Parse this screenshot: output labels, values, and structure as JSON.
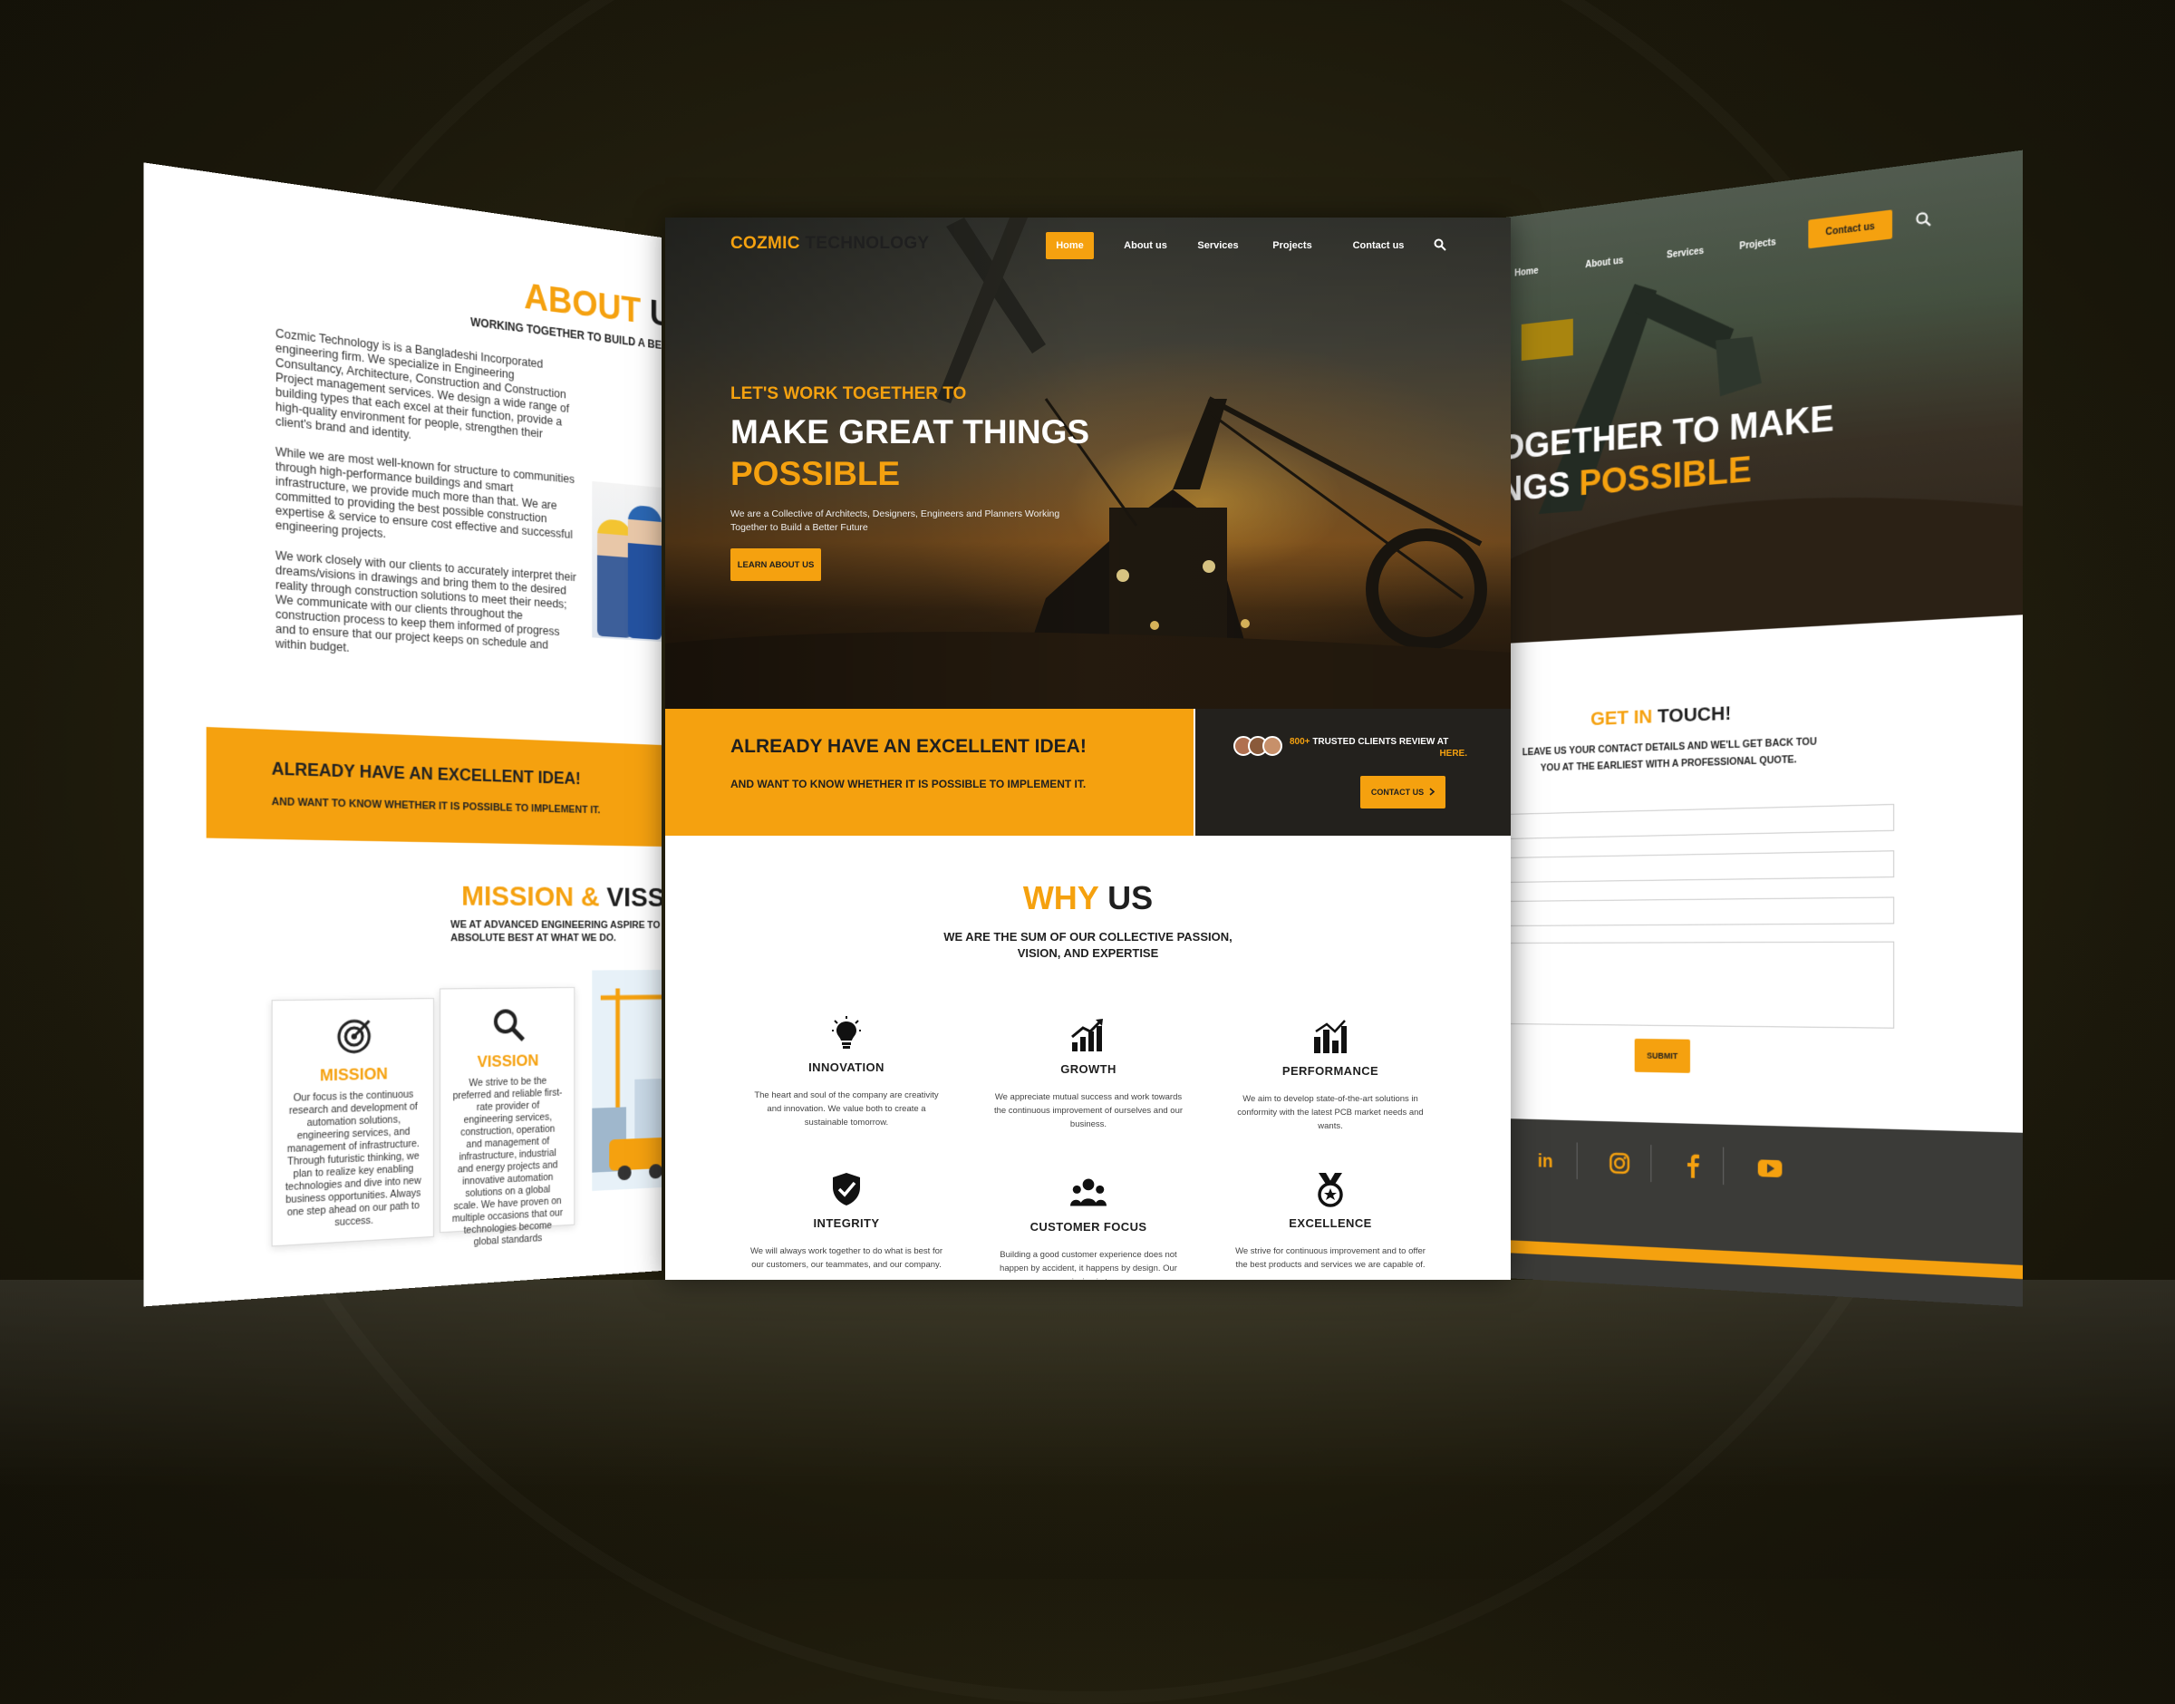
{
  "left": {
    "about_a": "ABOUT",
    "about_b": "US",
    "about_sub": "WORKING TOGETHER TO BUILD A BETTER F",
    "para1": "Cozmic Technology is is a Bangladeshi Incorporated engineering firm. We specialize in Engineering Consultancy, Architecture, Construction and Construction Project management services. We design a wide range of building types that each excel at their function, provide a high-quality environment for people, strengthen their client's brand and identity.",
    "para2": "While we are most well-known for structure to communities through high-performance buildings and smart infrastructure, we provide much more than that. We are committed to providing the best possible construction expertise & service to ensure cost effective and successful engineering projects.",
    "para3": "We work closely with our clients to accurately interpret their dreams/visions in drawings and bring them to the desired reality through construction solutions to meet their needs; We communicate with our clients throughout the construction process to keep them informed of progress and to ensure that our project keeps on schedule and within budget.",
    "band_title": "ALREADY HAVE AN EXCELLENT IDEA!",
    "band_sub": "AND WANT TO KNOW WHETHER IT IS POSSIBLE TO IMPLEMENT IT.",
    "mission_a": "MISSION &",
    "mission_b": "VISSI",
    "mission_sub": "WE AT ADVANCED ENGINEERING ASPIRE TO ABSOLUTE BEST AT WHAT WE DO.",
    "card1_title": "MISSION",
    "card1_text": "Our focus is the continuous research and development of automation solutions, engineering services, and management of infrastructure. Through futuristic thinking, we plan to realize key enabling technologies and dive into new business opportunities. Always one step ahead on our path to success.",
    "card2_title": "VISSION",
    "card2_text": "We strive to be the preferred and reliable first-rate provider of engineering services, construction, operation and management of infrastructure, industrial and energy projects and innovative automation solutions on a global scale. We have proven on multiple occasions that our technologies become global standards"
  },
  "center": {
    "logo_a": "COZMIC",
    "logo_b": "TECHNOLOGY",
    "nav": [
      "Home",
      "About us",
      "Services",
      "Projects",
      "Contact us"
    ],
    "eyebrow": "LET'S WORK TOGETHER TO",
    "headline": "MAKE GREAT THINGS",
    "headline_accent": "POSSIBLE",
    "description": "We are a Collective of Architects, Designers, Engineers and Planners Working Together to Build a Better Future",
    "learn_btn": "LEARN ABOUT US",
    "cta_title": "ALREADY HAVE AN EXCELLENT IDEA!",
    "cta_sub": "AND WANT TO KNOW WHETHER IT IS POSSIBLE TO IMPLEMENT IT.",
    "reviews_a": "800+",
    "reviews_b": "TRUSTED CLIENTS REVIEW AT",
    "reviews_link": "HERE.",
    "contact_btn": "CONTACT US",
    "why_a": "WHY",
    "why_b": "US",
    "why_sub": "WE ARE THE SUM OF OUR COLLECTIVE PASSION, VISION, AND EXPERTISE",
    "features": [
      {
        "icon": "lightbulb-icon",
        "title": "INNOVATION",
        "text": "The heart and soul of the company are creativity and innovation. We value both to create a sustainable tomorrow."
      },
      {
        "icon": "growth-chart-icon",
        "title": "GROWTH",
        "text": "We appreciate mutual success and work towards the continuous improvement of ourselves and our business."
      },
      {
        "icon": "bar-chart-icon",
        "title": "PERFORMANCE",
        "text": "We aim to develop state-of-the-art solutions in conformity with the latest PCB market needs and wants."
      },
      {
        "icon": "shield-check-icon",
        "title": "INTEGRITY",
        "text": "We will always work together to do what is best for our customers, our teammates, and our company."
      },
      {
        "icon": "people-icon",
        "title": "CUSTOMER FOCUS",
        "text": "Building a good customer experience does not happen by accident, it happens by design. Our mission is to"
      },
      {
        "icon": "medal-icon",
        "title": "EXCELLENCE",
        "text": "We strive for continuous improvement and to offer the best products and services we are capable of."
      }
    ]
  },
  "right": {
    "nav": [
      "Home",
      "About us",
      "Services",
      "Projects"
    ],
    "contact_btn": "Contact us",
    "headline": "OGETHER TO MAKE",
    "headline2_a": "NGS",
    "headline2_b": "POSSIBLE",
    "touch_a": "GET IN",
    "touch_b": "TOUCH!",
    "touch_sub": "LEAVE US YOUR CONTACT DETAILS AND WE'LL GET BACK TOU YOU AT THE EARLIEST WITH A PROFESSIONAL QUOTE.",
    "submit": "SUBMIT",
    "social": [
      "linkedin-icon",
      "instagram-icon",
      "facebook-icon",
      "youtube-icon"
    ]
  },
  "colors": {
    "accent": "#f5a10f",
    "dark": "#1f1f1f",
    "footer": "#3b3b38"
  }
}
